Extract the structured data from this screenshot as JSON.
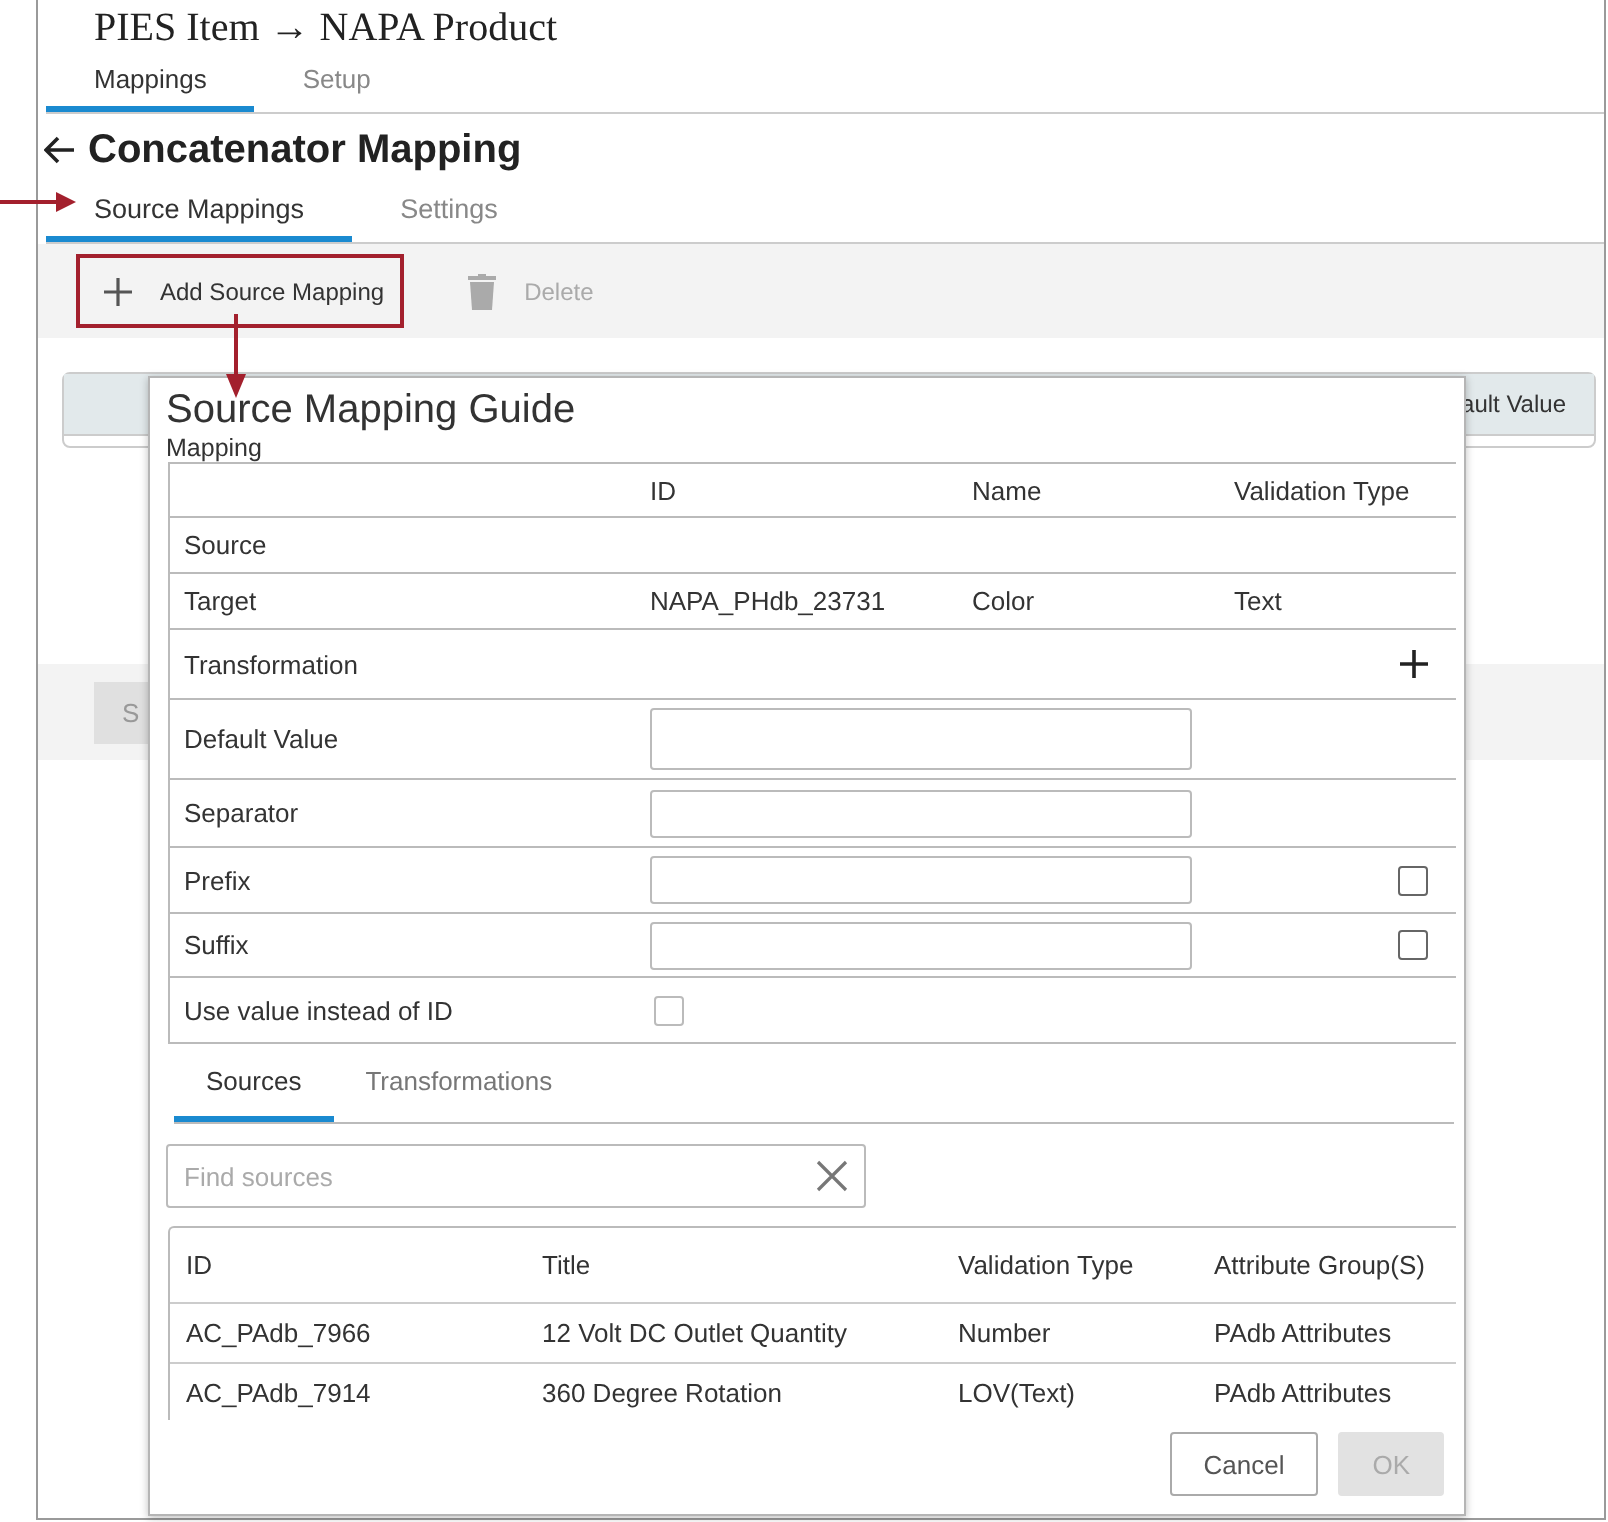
{
  "app": {
    "title": "PIES Item → NAPA Product",
    "tabs": [
      {
        "label": "Mappings",
        "selected": true
      },
      {
        "label": "Setup",
        "selected": false
      }
    ]
  },
  "page": {
    "title": "Concatenator Mapping",
    "tabs": [
      {
        "label": "Source Mappings",
        "selected": true
      },
      {
        "label": "Settings",
        "selected": false
      }
    ],
    "toolbar": [
      {
        "label": "Add Source Mapping",
        "disabled": false,
        "highlighted": true
      },
      {
        "label": "Delete",
        "disabled": true,
        "highlighted": false
      }
    ],
    "table": {
      "columns": [
        "ault Value"
      ]
    },
    "footer_buttons": [
      {
        "label": "S",
        "disabled": true
      }
    ]
  },
  "dialog": {
    "title": "Source Mapping Guide",
    "section": "Mapping",
    "columns": [
      "ID",
      "Name",
      "Validation Type"
    ],
    "rows": [
      {
        "kind": "info",
        "label": "Source"
      },
      {
        "kind": "info",
        "label": "Target",
        "id": "NAPA_PHdb_23731",
        "name": "Color",
        "validation_type": "Text"
      },
      {
        "kind": "add",
        "label": "Transformation"
      },
      {
        "kind": "input",
        "label": "Default Value"
      },
      {
        "kind": "input",
        "label": "Separator"
      },
      {
        "kind": "input",
        "label": "Prefix",
        "checked": false
      },
      {
        "kind": "input",
        "label": "Suffix",
        "checked": false
      },
      {
        "kind": "checkbox",
        "label": "Use value instead of ID",
        "checked": false
      }
    ],
    "tabs": [
      {
        "label": "Sources",
        "selected": true
      },
      {
        "label": "Transformations",
        "selected": false
      }
    ],
    "search": {
      "placeholder": "Find sources"
    },
    "sources": {
      "columns": [
        "ID",
        "Title",
        "Validation Type",
        "Attribute Group(S)"
      ],
      "rows": [
        [
          "AC_PAdb_7966",
          "12 Volt DC Outlet Quantity",
          "Number",
          "PAdb Attributes"
        ],
        [
          "AC_PAdb_7914",
          "360 Degree Rotation",
          "LOV(Text)",
          "PAdb Attributes"
        ]
      ]
    },
    "buttons": [
      {
        "label": "Cancel",
        "disabled": false
      },
      {
        "label": "OK",
        "disabled": true
      }
    ]
  }
}
